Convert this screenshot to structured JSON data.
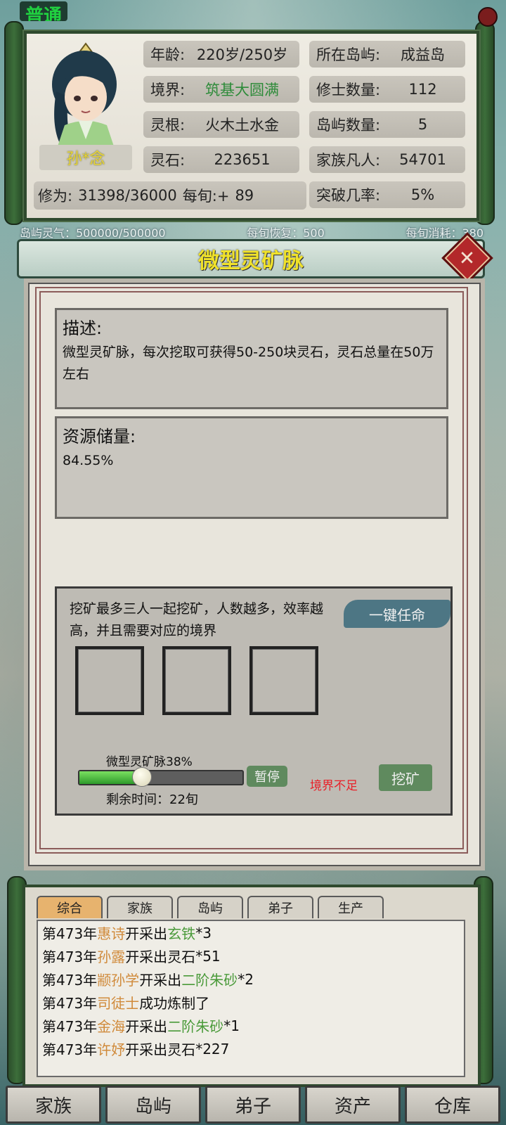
{
  "corner_tag": "普通",
  "profile": {
    "name": "孙*念",
    "age_label": "年龄:",
    "age_value": "220岁/250岁",
    "realm_label": "境界:",
    "realm_value": "筑基大圆满",
    "root_label": "灵根:",
    "root_value": "火木土水金",
    "stone_label": "灵石:",
    "stone_value": "223651",
    "island_label": "所在岛屿:",
    "island_value": "成益岛",
    "cultivators_label": "修士数量:",
    "cultivators_value": "112",
    "islands_label": "岛屿数量:",
    "islands_value": "5",
    "mortals_label": "家族凡人:",
    "mortals_value": "54701",
    "cult_label": "修为:",
    "cult_value": "31398/36000",
    "per_turn_label": "每旬:+",
    "per_turn_value": "89",
    "breakthrough_label": "突破几率:",
    "breakthrough_value": "5%"
  },
  "island_info": {
    "qi": "岛屿灵气：500000/500000",
    "recover": "每旬恢复：500",
    "consume": "每旬消耗：380"
  },
  "dialog": {
    "title": "微型灵矿脉",
    "desc_title": "描述:",
    "desc_text": "微型灵矿脉，每次挖取可获得50-250块灵石，灵石总量在50万左右",
    "reserve_title": "资源储量:",
    "reserve_value": "84.55%",
    "tip": "挖矿最多三人一起挖矿，人数越多，效率越高，并且需要对应的境界",
    "auto_button": "一键任命",
    "progress_label": "微型灵矿脉38%",
    "progress_fraction": 0.38,
    "pause_button": "暂停",
    "warning": "境界不足",
    "mine_button": "挖矿",
    "remaining": "剩余时间：22旬"
  },
  "log": {
    "tabs": [
      "综合",
      "家族",
      "岛屿",
      "弟子",
      "生产"
    ],
    "active_tab": 0,
    "rows": [
      {
        "year": "第473年",
        "who": "惠诗",
        "action": "开采出",
        "item": "玄铁",
        "tail": "*3",
        "item_colored": true
      },
      {
        "year": "第473年",
        "who": "孙露",
        "action": "开采出",
        "item": "灵石",
        "tail": "*51",
        "item_colored": false
      },
      {
        "year": "第473年",
        "who": "颛孙学",
        "action": "开采出",
        "item": "二阶朱砂",
        "tail": "*2",
        "item_colored": true
      },
      {
        "year": "第473年",
        "who": "司徒士",
        "action": "成功炼制了",
        "item": "",
        "tail": "",
        "item_colored": false
      },
      {
        "year": "第473年",
        "who": "金海",
        "action": "开采出",
        "item": "二阶朱砂",
        "tail": "*1",
        "item_colored": true
      },
      {
        "year": "第473年",
        "who": "许妤",
        "action": "开采出",
        "item": "灵石",
        "tail": "*227",
        "item_colored": false
      }
    ]
  },
  "nav": [
    "家族",
    "岛屿",
    "弟子",
    "资产",
    "仓库"
  ]
}
